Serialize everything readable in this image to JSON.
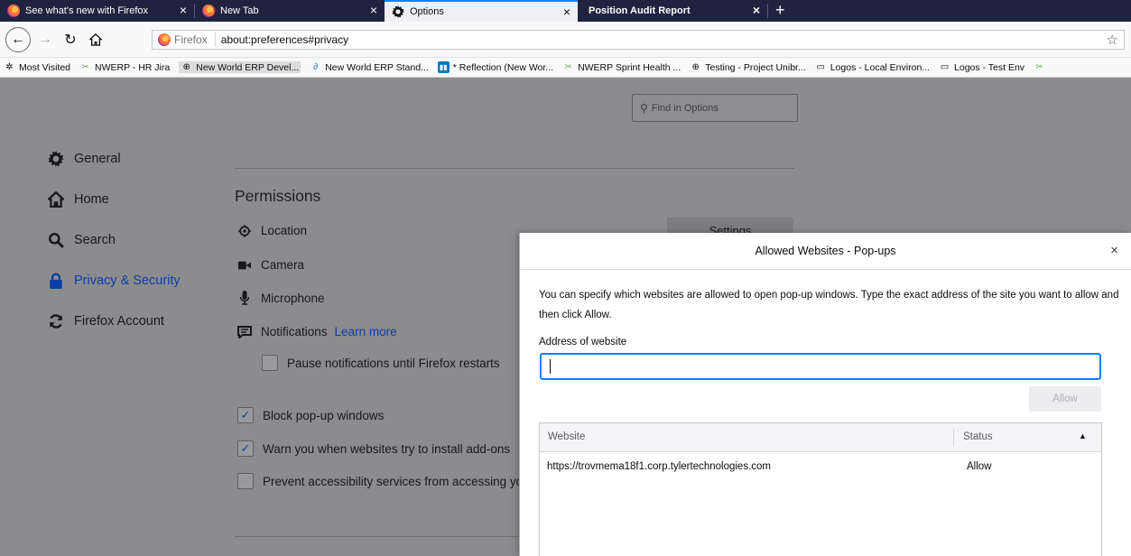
{
  "tabs": [
    {
      "title": "See what's new with Firefox",
      "icon": "firefox-icon"
    },
    {
      "title": "New Tab",
      "icon": "firefox-icon"
    },
    {
      "title": "Options",
      "icon": "gear-icon",
      "active": true
    },
    {
      "title": "Position Audit Report",
      "icon": ""
    }
  ],
  "tab_close": "×",
  "new_tab": "+",
  "navbar": {
    "identity_label": "Firefox",
    "url": "about:preferences#privacy"
  },
  "bookmarks": [
    {
      "label": "Most Visited",
      "icon": "gear-icon"
    },
    {
      "label": "NWERP - HR Jira",
      "icon": "jira-icon"
    },
    {
      "label": "New World ERP Devel...",
      "icon": "globe-icon"
    },
    {
      "label": "New World ERP Stand...",
      "icon": "confluence-icon"
    },
    {
      "label": "* Reflection (New Wor...",
      "icon": "trello-icon"
    },
    {
      "label": "NWERP Sprint Health ...",
      "icon": "jira-icon"
    },
    {
      "label": "Testing - Project Unibr...",
      "icon": "globe-icon"
    },
    {
      "label": "Logos - Local Environ...",
      "icon": "folder-icon"
    },
    {
      "label": "Logos - Test Env",
      "icon": "folder-icon"
    }
  ],
  "find_placeholder": "Find in Options",
  "categories": [
    {
      "label": "General",
      "icon": "gear-icon"
    },
    {
      "label": "Home",
      "icon": "home-icon"
    },
    {
      "label": "Search",
      "icon": "search-icon"
    },
    {
      "label": "Privacy & Security",
      "icon": "lock-icon",
      "selected": true
    },
    {
      "label": "Firefox Account",
      "icon": "sync-icon"
    }
  ],
  "permissions": {
    "title": "Permissions",
    "items": [
      "Location",
      "Camera",
      "Microphone",
      "Notifications"
    ],
    "learn_more": "Learn more",
    "settings_button": "Settings",
    "pause_notifications": "Pause notifications until Firefox restarts",
    "block_popups": "Block pop-up windows",
    "warn_addons": "Warn you when websites try to install add-ons",
    "prevent_accessibility": "Prevent accessibility services from accessing your browser"
  },
  "dialog": {
    "title": "Allowed Websites - Pop-ups",
    "close": "×",
    "description": "You can specify which websites are allowed to open pop-up windows. Type the exact address of the site you want to allow and then click Allow.",
    "address_label": "Address of website",
    "address_value": "",
    "allow_button": "Allow",
    "columns": [
      "Website",
      "Status"
    ],
    "rows": [
      {
        "website": "https://trovmema18f1.corp.tylertechnologies.com",
        "status": "Allow"
      }
    ]
  }
}
